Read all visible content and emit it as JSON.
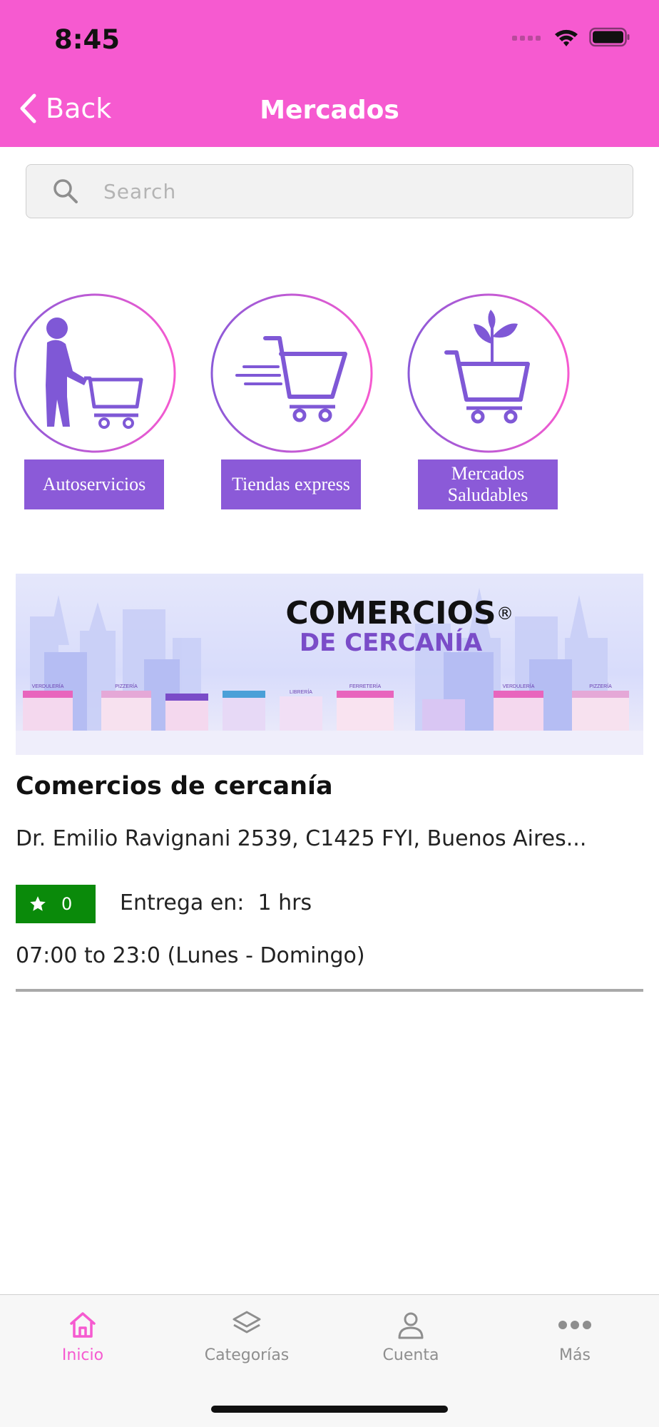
{
  "status_bar": {
    "time": "8:45"
  },
  "nav": {
    "back_label": "Back",
    "title": "Mercados"
  },
  "search": {
    "placeholder": "Search"
  },
  "categories": [
    {
      "label": "Autoservicios",
      "icon": "person-with-cart-icon"
    },
    {
      "label": "Tiendas express",
      "icon": "fast-cart-icon"
    },
    {
      "label": "Mercados Saludables",
      "icon": "cart-with-plant-icon"
    }
  ],
  "store": {
    "banner": {
      "line1": "COMERCIOS",
      "registered": "®",
      "line2": "DE CERCANÍA",
      "shop_signs": [
        "VERDULERÍA",
        "PIZZERÍA",
        "LIBRERÍA",
        "FERRETERÍA",
        "VERDULERÍA",
        "PIZZERÍA"
      ]
    },
    "name": "Comercios de cercanía",
    "address": "Dr. Emilio Ravignani 2539, C1425 FYI, Buenos Aires...",
    "rating": "0",
    "delivery": "Entrega en:  1 hrs",
    "hours": "07:00 to 23:0 (Lunes - Domingo)"
  },
  "tabbar": {
    "items": [
      {
        "label": "Inicio",
        "icon": "home-icon",
        "active": true
      },
      {
        "label": "Categorías",
        "icon": "layers-icon",
        "active": false
      },
      {
        "label": "Cuenta",
        "icon": "user-icon",
        "active": false
      },
      {
        "label": "Más",
        "icon": "more-icon",
        "active": false
      }
    ]
  },
  "colors": {
    "accent": "#f65ad0",
    "purple": "#8b5ad8",
    "rating_green": "#0a8a0a"
  }
}
